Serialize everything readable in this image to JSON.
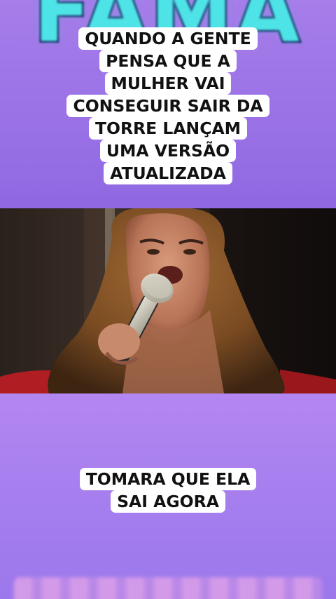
{
  "top_logo": {
    "text": "FAMA"
  },
  "top_caption": {
    "lines": [
      "QUANDO A GENTE",
      "PENSA QUE A",
      "MULHER VAI",
      "CONSEGUIR SAIR DA",
      "TORRE LANÇAM",
      "UMA VERSÃO",
      "ATUALIZADA"
    ]
  },
  "video": {
    "subject_icon": "singer-with-microphone-icon"
  },
  "bottom_caption": {
    "lines": [
      "TOMARA QUE ELA",
      "SAI AGORA"
    ]
  },
  "colors": {
    "top_panel": "#9b72e6",
    "bottom_panel": "#a67eee",
    "caption_bg": "#ffffff",
    "caption_text": "#111111",
    "logo_fill": "#4ee3e6",
    "logo_stroke": "#1e2f6b"
  }
}
